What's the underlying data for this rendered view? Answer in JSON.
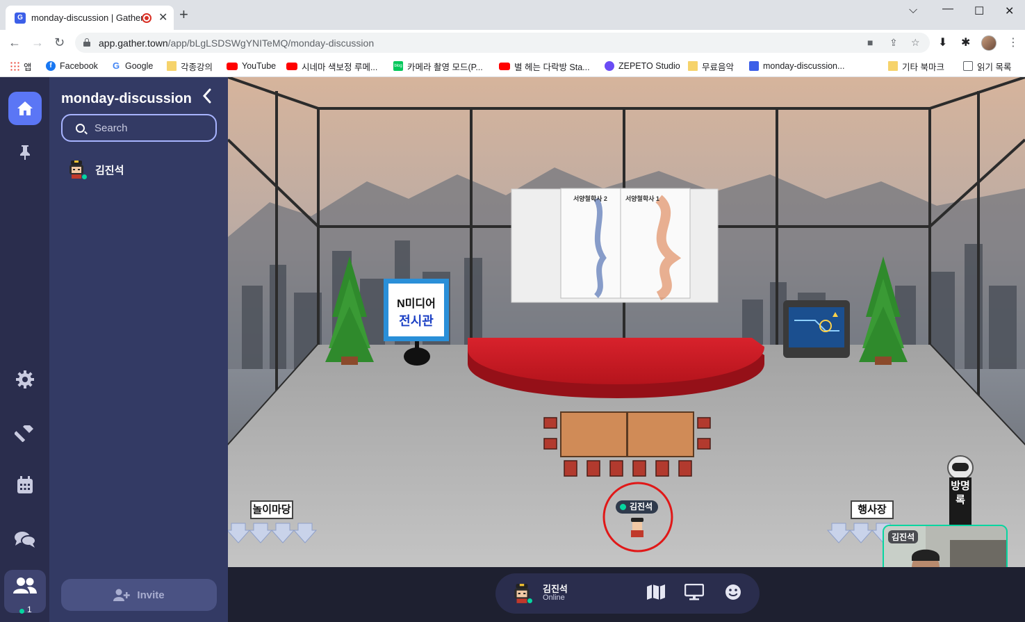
{
  "browser": {
    "tab_title": "monday-discussion | Gather",
    "tab_favicon_letter": "G",
    "new_tab_glyph": "+",
    "url_host": "app.gather.town",
    "url_path": "/app/bLgLSDSWgYNITeMQ/monday-discussion",
    "bookmarks": [
      {
        "label": "앱",
        "icon": "apps-icon"
      },
      {
        "label": "Facebook",
        "icon": "facebook-icon"
      },
      {
        "label": "Google",
        "icon": "google-icon"
      },
      {
        "label": "각종강의",
        "icon": "folder-icon"
      },
      {
        "label": "YouTube",
        "icon": "youtube-icon"
      },
      {
        "label": "시네마 색보정 루메...",
        "icon": "youtube-icon"
      },
      {
        "label": "카메라 촬영 모드(P...",
        "icon": "blog-icon"
      },
      {
        "label": "별 헤는 다락방 Sta...",
        "icon": "youtube-icon"
      },
      {
        "label": "ZEPETO Studio",
        "icon": "zepeto-icon"
      },
      {
        "label": "무료음악",
        "icon": "folder-icon"
      },
      {
        "label": "monday-discussion...",
        "icon": "gather-icon"
      }
    ],
    "other_bookmarks": "기타 북마크",
    "reading_list": "읽기 목록"
  },
  "sidebar": {
    "room_title": "monday-discussion",
    "search_placeholder": "Search",
    "members": [
      {
        "name": "김진석",
        "status": "online"
      }
    ],
    "invite_label": "Invite",
    "people_count": "1"
  },
  "map": {
    "stage_screen_books": [
      "서양철학사 2",
      "서양철학사 1"
    ],
    "sign_exhibit": {
      "line1": "N미디어",
      "line2": "전시관"
    },
    "portal_left": "놀이마당",
    "portal_right": "행사장",
    "bot_label": "방명록",
    "player_name": "김진석"
  },
  "dock": {
    "name": "김진석",
    "status": "Online"
  },
  "video": {
    "name": "김진석"
  },
  "colors": {
    "accent": "#5b76f5",
    "online": "#06d6a0",
    "rail": "#2a2d4d",
    "panel": "#333a64"
  }
}
